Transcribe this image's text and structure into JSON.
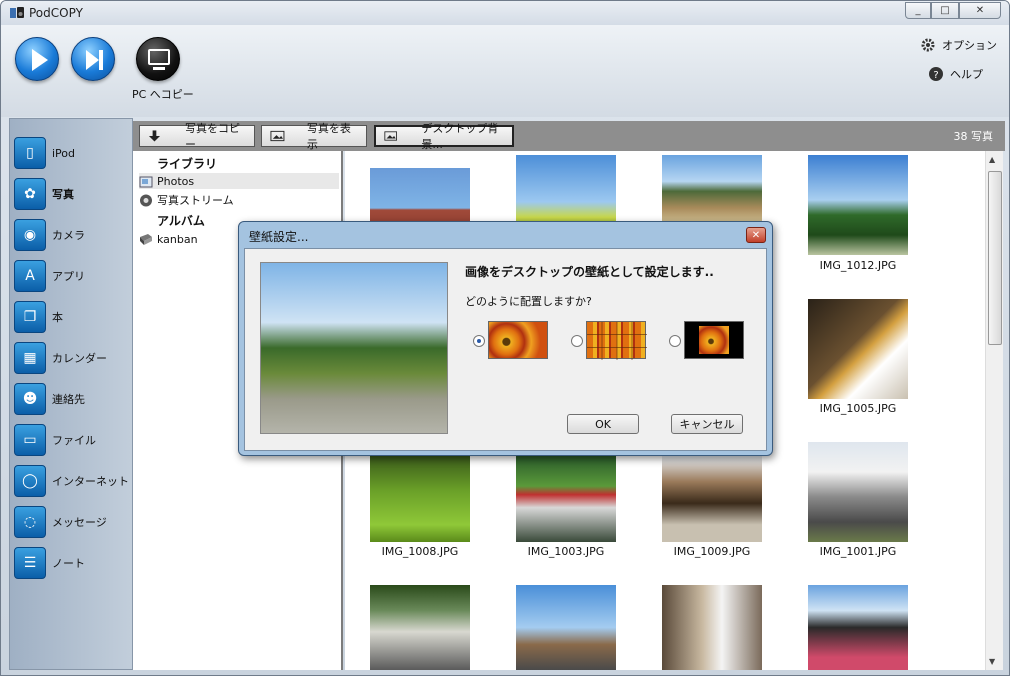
{
  "app": {
    "title": "PodCOPY"
  },
  "window_buttons": {
    "minimize": "_",
    "maximize": "□",
    "close": "✕"
  },
  "toolbar": {
    "pc_copy_label": "PC へコピー",
    "options_label": "オプション",
    "help_label": "ヘルプ"
  },
  "sidebar": {
    "items": [
      {
        "label": "iPod",
        "icon": "ipod-icon"
      },
      {
        "label": "写真",
        "icon": "photo-flower-icon"
      },
      {
        "label": "カメラ",
        "icon": "camera-icon"
      },
      {
        "label": "アプリ",
        "icon": "app-store-icon"
      },
      {
        "label": "本",
        "icon": "book-icon"
      },
      {
        "label": "カレンダー",
        "icon": "calendar-icon"
      },
      {
        "label": "連絡先",
        "icon": "contacts-icon"
      },
      {
        "label": "ファイル",
        "icon": "folder-icon"
      },
      {
        "label": "インターネット",
        "icon": "globe-icon"
      },
      {
        "label": "メッセージ",
        "icon": "speech-bubble-icon"
      },
      {
        "label": "ノート",
        "icon": "notes-icon"
      }
    ]
  },
  "action_bar": {
    "copy_photos": "写真をコピー",
    "show_photos": "写真を表示",
    "desktop_bg": "デスクトップ背景...",
    "count": "38 写真"
  },
  "tree": {
    "library_heading": "ライブラリ",
    "photos": "Photos",
    "photo_stream": "写真ストリーム",
    "album_heading": "アルバム",
    "kanban": "kanban"
  },
  "photos": [
    {
      "name": "IMG_1012.JPG"
    },
    {
      "name": "IMG_1005.JPG"
    },
    {
      "name": "IMG_1008.JPG"
    },
    {
      "name": "IMG_1003.JPG"
    },
    {
      "name": "IMG_1009.JPG"
    },
    {
      "name": "IMG_1001.JPG"
    }
  ],
  "dialog": {
    "title": "壁紙設定...",
    "message": "画像をデスクトップの壁紙として設定します..",
    "question": "どのように配置しますか?",
    "ok": "OK",
    "cancel": "キャンセル",
    "selected_option": "stretch"
  }
}
